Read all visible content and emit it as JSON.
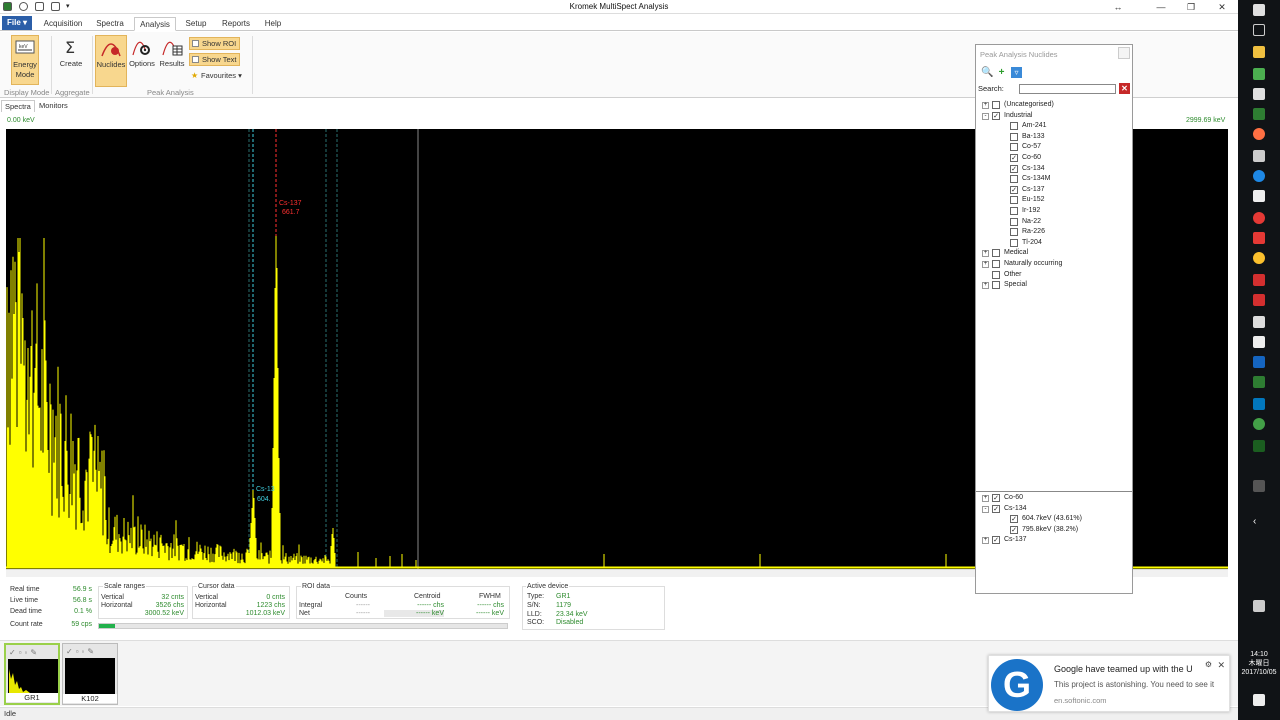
{
  "window": {
    "title": "Kromek MultiSpect Analysis"
  },
  "menu": {
    "file": "File ▾",
    "tabs": [
      "Acquisition",
      "Spectra",
      "Analysis",
      "Setup",
      "Reports",
      "Help"
    ],
    "active_tab": "Analysis"
  },
  "ribbon": {
    "energy_mode": "Energy Mode",
    "create": "Create",
    "nuclides": "Nuclides",
    "options": "Options",
    "results": "Results",
    "show_roi": "Show ROI",
    "show_text": "Show Text",
    "favourites": "Favourites ▾",
    "group_display_mode": "Display Mode",
    "group_aggregate": "Aggregate",
    "group_peak_analysis": "Peak Analysis"
  },
  "view_tabs": [
    "Spectra",
    "Monitors"
  ],
  "spectrum": {
    "kev_left": "0.00 keV",
    "kev_right": "2999.69 keV",
    "peak_label_1_name": "Cs-137",
    "peak_label_1_energy": "661.7",
    "peak_label_2_name": "Cs-13",
    "peak_label_2_energy": "604."
  },
  "data_panel": {
    "real_time_label": "Real time",
    "real_time": "56.9 s",
    "live_time_label": "Live time",
    "live_time": "56.8 s",
    "dead_time_label": "Dead time",
    "dead_time": "0.1 %",
    "count_rate_label": "Count rate",
    "count_rate": "59 cps",
    "count_rate_fraction": 0.04,
    "scale_ranges_title": "Scale ranges",
    "vertical_label": "Vertical",
    "vertical_value": "32 cnts",
    "horizontal_label": "Horizontal",
    "horizontal_value_1": "3526 chs",
    "horizontal_value_2": "3000.52 keV",
    "cursor_title": "Cursor data",
    "cursor_vertical_label": "Vertical",
    "cursor_vertical_value": "0 cnts",
    "cursor_horizontal_label": "Horizontal",
    "cursor_horizontal_value_1": "1223 chs",
    "cursor_horizontal_value_2": "1012.03 keV",
    "roi_title": "ROI data",
    "counts_label": "Counts",
    "centroid_label": "Centroid",
    "fwhm_label": "FWHM",
    "integral_label": "Integral",
    "net_label": "Net",
    "roi_dash": "------",
    "centroid_chs": "------ chs",
    "centroid_kev": "------ keV",
    "fwhm_chs": "------ chs",
    "fwhm_kev": "------ keV",
    "active_device_title": "Active device",
    "type_label": "Type:",
    "type_value": "GR1",
    "sn_label": "S/N:",
    "sn_value": "1179",
    "lld_label": "LLD:",
    "lld_value": "23.34 keV",
    "sco_label": "SCO:",
    "sco_value": "Disabled"
  },
  "devices": [
    {
      "label": "GR1"
    },
    {
      "label": "K102"
    }
  ],
  "status": {
    "text": "Idle"
  },
  "nuclide_panel": {
    "title": "Peak Analysis Nuclides",
    "search_label": "Search:",
    "search_value": "",
    "tree": [
      {
        "label": "(Uncategorised)",
        "checked": false,
        "indent": 0,
        "exp": "+"
      },
      {
        "label": "Industrial",
        "checked": true,
        "indent": 0,
        "exp": "-"
      },
      {
        "label": "Am-241",
        "checked": false,
        "indent": 1
      },
      {
        "label": "Ba-133",
        "checked": false,
        "indent": 1
      },
      {
        "label": "Co-57",
        "checked": false,
        "indent": 1
      },
      {
        "label": "Co-60",
        "checked": true,
        "indent": 1
      },
      {
        "label": "Cs-134",
        "checked": true,
        "indent": 1
      },
      {
        "label": "Cs-134M",
        "checked": false,
        "indent": 1
      },
      {
        "label": "Cs-137",
        "checked": true,
        "indent": 1
      },
      {
        "label": "Eu-152",
        "checked": false,
        "indent": 1
      },
      {
        "label": "Ir-192",
        "checked": false,
        "indent": 1
      },
      {
        "label": "Na-22",
        "checked": false,
        "indent": 1
      },
      {
        "label": "Ra-226",
        "checked": false,
        "indent": 1
      },
      {
        "label": "Tl-204",
        "checked": false,
        "indent": 1
      },
      {
        "label": "Medical",
        "checked": false,
        "indent": 0,
        "exp": "+"
      },
      {
        "label": "Naturally occurring",
        "checked": false,
        "indent": 0,
        "exp": "+"
      },
      {
        "label": "Other",
        "checked": false,
        "indent": 0
      },
      {
        "label": "Special",
        "checked": false,
        "indent": 0,
        "exp": "+"
      }
    ],
    "selected": [
      {
        "label": "Co-60",
        "checked": true,
        "indent": 0,
        "exp": "+"
      },
      {
        "label": "Cs-134",
        "checked": true,
        "indent": 0,
        "exp": "-"
      },
      {
        "label": "604.7keV (43.61%)",
        "checked": true,
        "indent": 1
      },
      {
        "label": "795.8keV (38.2%)",
        "checked": true,
        "indent": 1
      },
      {
        "label": "Cs-137",
        "checked": true,
        "indent": 0,
        "exp": "+"
      }
    ]
  },
  "notification": {
    "title": "Google have teamed up with the U",
    "body": "This project is astonishing. You need to see it",
    "source": "en.softonic.com"
  },
  "clock": {
    "time": "14:10",
    "day": "木曜日",
    "date": "2017/10/05"
  },
  "colors": {
    "accent": "#2b5ea8",
    "spectrum": "#ffff00",
    "peak_red": "#ff3030",
    "peak_cyan": "#40d0e0",
    "count_bar": "#22b14c"
  }
}
